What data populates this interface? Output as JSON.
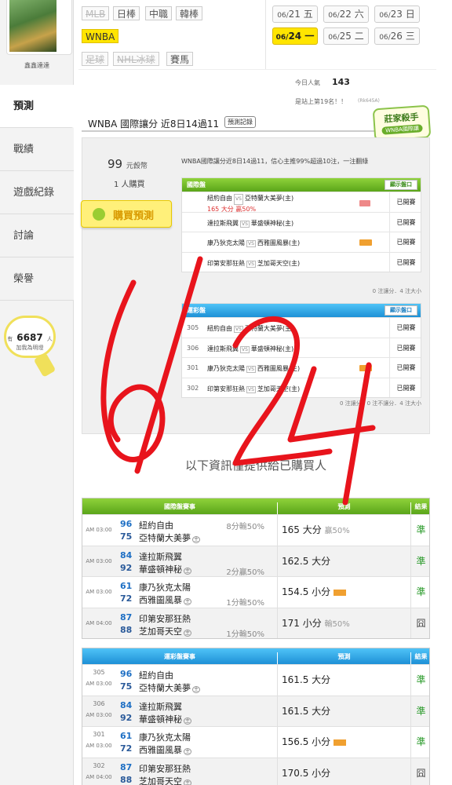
{
  "sidebar": {
    "username": "鑫鑫達達",
    "items": [
      {
        "label": "預測"
      },
      {
        "label": "戰績"
      },
      {
        "label": "遊戲紀錄"
      },
      {
        "label": "討論"
      },
      {
        "label": "榮譽"
      }
    ],
    "friends": {
      "prefix": "有",
      "count": "6687",
      "suffix": "人",
      "caption": "加我為明燈"
    }
  },
  "filters": {
    "row1": [
      "MLB",
      "日棒",
      "中職",
      "韓棒"
    ],
    "row2": [
      "WNBA"
    ],
    "row3": [
      "足球",
      "NHL冰球",
      "賽馬"
    ]
  },
  "dates": [
    {
      "m": "06/",
      "d": "21",
      "w": "五"
    },
    {
      "m": "06/",
      "d": "22",
      "w": "六"
    },
    {
      "m": "06/",
      "d": "23",
      "w": "日"
    },
    {
      "m": "06/",
      "d": "24",
      "w": "一"
    },
    {
      "m": "06/",
      "d": "25",
      "w": "二"
    },
    {
      "m": "06/",
      "d": "26",
      "w": "三"
    }
  ],
  "stats": {
    "popularity_label": "今日人氣",
    "popularity_value": "143",
    "rank_text": "是站上第19名！！",
    "rank_sub": "(Rk645A)"
  },
  "title": {
    "text": "WNBA 國際讓分 近8日14過11",
    "record_button": "預測記錄",
    "expert_title": "莊家殺手",
    "expert_sub": "WNBA國際讓"
  },
  "panel": {
    "price": "99",
    "price_unit": "元㲃幣",
    "buyers": "1 人購買",
    "buy_button": "購買預測",
    "summary": "WNBA國際讓分近8日14過11，信心主推99%超過10注，一注翻綠",
    "intl": {
      "header": "國際盤",
      "show": "顯示盤口",
      "rows": [
        {
          "num": "",
          "away": "紐約自由",
          "home": "亞特蘭大美夢(主)",
          "line": "165 大分 贏50%",
          "res": "已開賽"
        },
        {
          "num": "",
          "away": "達拉斯飛翼",
          "home": "華盛頓神秘(主)",
          "line": "",
          "res": "已開賽"
        },
        {
          "num": "",
          "away": "康乃狄克太陽",
          "home": "西雅圖風暴(主)",
          "line": "",
          "res": "已開賽"
        },
        {
          "num": "",
          "away": "印第安那狂熱",
          "home": "芝加哥天空(主)",
          "line": "",
          "res": "已開賽"
        }
      ],
      "foot": "0 注讓分．4 注大小"
    },
    "sport": {
      "header": "運彩盤",
      "show": "顯示盤口",
      "rows": [
        {
          "num": "305",
          "away": "紐約自由",
          "home": "亞特蘭大美夢(主)",
          "res": "已開賽"
        },
        {
          "num": "306",
          "away": "達拉斯飛翼",
          "home": "華盛頓神秘(主)",
          "res": "已開賽"
        },
        {
          "num": "301",
          "away": "康乃狄克太陽",
          "home": "西雅圖風暴(主)",
          "res": "已開賽"
        },
        {
          "num": "302",
          "away": "印第安那狂熱",
          "home": "芝加哥天空(主)",
          "res": "已開賽"
        }
      ],
      "foot": "0 注讓分．0 注不讓分．4 注大小"
    }
  },
  "notice": "以下資訊僅提供給已購買人",
  "table1": {
    "h1": "國際盤賽事",
    "h2": "預測",
    "h3": "結果",
    "rows": [
      {
        "time": "AM 03:00",
        "n1": "96",
        "t1": "紐約自由",
        "n2": "75",
        "t2": "亞特蘭大美夢",
        "spread": "8分輸50%",
        "spreadRow": 1,
        "pred": "165 大分",
        "predSub": "贏50%",
        "res": "準"
      },
      {
        "time": "AM 03:00",
        "n1": "84",
        "t1": "達拉斯飛翼",
        "n2": "92",
        "t2": "華盛頓神秘",
        "spread": "2分贏50%",
        "spreadRow": 2,
        "pred": "162.5 大分",
        "predSub": "",
        "res": "準"
      },
      {
        "time": "AM 03:00",
        "n1": "61",
        "t1": "康乃狄克太陽",
        "n2": "72",
        "t2": "西雅圖風暴",
        "spread": "1分輸50%",
        "spreadRow": 2,
        "pred": "154.5 小分",
        "predSub": "",
        "res": "準"
      },
      {
        "time": "AM 04:00",
        "n1": "87",
        "t1": "印第安那狂熱",
        "n2": "88",
        "t2": "芝加哥天空",
        "spread": "1分輸50%",
        "spreadRow": 2,
        "pred": "171 小分",
        "predSub": "輸50%",
        "res": "囧"
      }
    ]
  },
  "table2": {
    "h1": "運彩盤賽事",
    "h2": "預測",
    "h3": "結果",
    "rows": [
      {
        "id": "305",
        "time": "AM 03:00",
        "n1": "96",
        "t1": "紐約自由",
        "n2": "75",
        "t2": "亞特蘭大美夢",
        "pred": "161.5 大分",
        "res": "準"
      },
      {
        "id": "306",
        "time": "AM 03:00",
        "n1": "84",
        "t1": "達拉斯飛翼",
        "n2": "92",
        "t2": "華盛頓神秘",
        "pred": "161.5 大分",
        "res": "準"
      },
      {
        "id": "301",
        "time": "AM 03:00",
        "n1": "61",
        "t1": "康乃狄克太陽",
        "n2": "72",
        "t2": "西雅圖風暴",
        "pred": "156.5 小分",
        "res": "準"
      },
      {
        "id": "302",
        "time": "AM 04:00",
        "n1": "87",
        "t1": "印第安那狂熱",
        "n2": "88",
        "t2": "芝加哥天空",
        "pred": "170.5 小分",
        "res": "囧"
      }
    ]
  },
  "home_mark": "主",
  "handwriting": "6/24"
}
